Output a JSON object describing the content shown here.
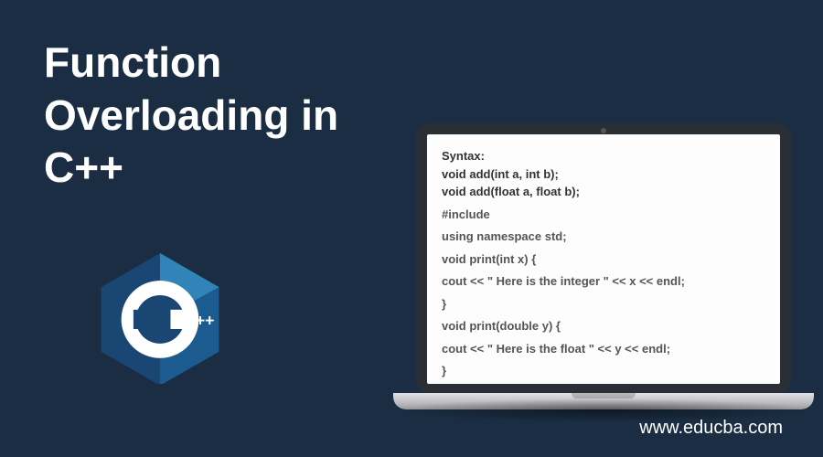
{
  "heading": "Function Overloading in C++",
  "logo": {
    "label": "C++",
    "name": "cpp-logo"
  },
  "code": {
    "syntax_header": "Syntax:",
    "line1": "void add(int a, int b);",
    "line2": "void add(float a, float b);",
    "line3": "#include",
    "line4": "using namespace std;",
    "line5": "void print(int x) {",
    "line6": "cout << \" Here is the integer \" << x << endl;",
    "line7": "}",
    "line8": "void print(double  y) {",
    "line9": "cout << \" Here is the float \" << y << endl;",
    "line10": "}"
  },
  "footer_text": "www.educba.com"
}
